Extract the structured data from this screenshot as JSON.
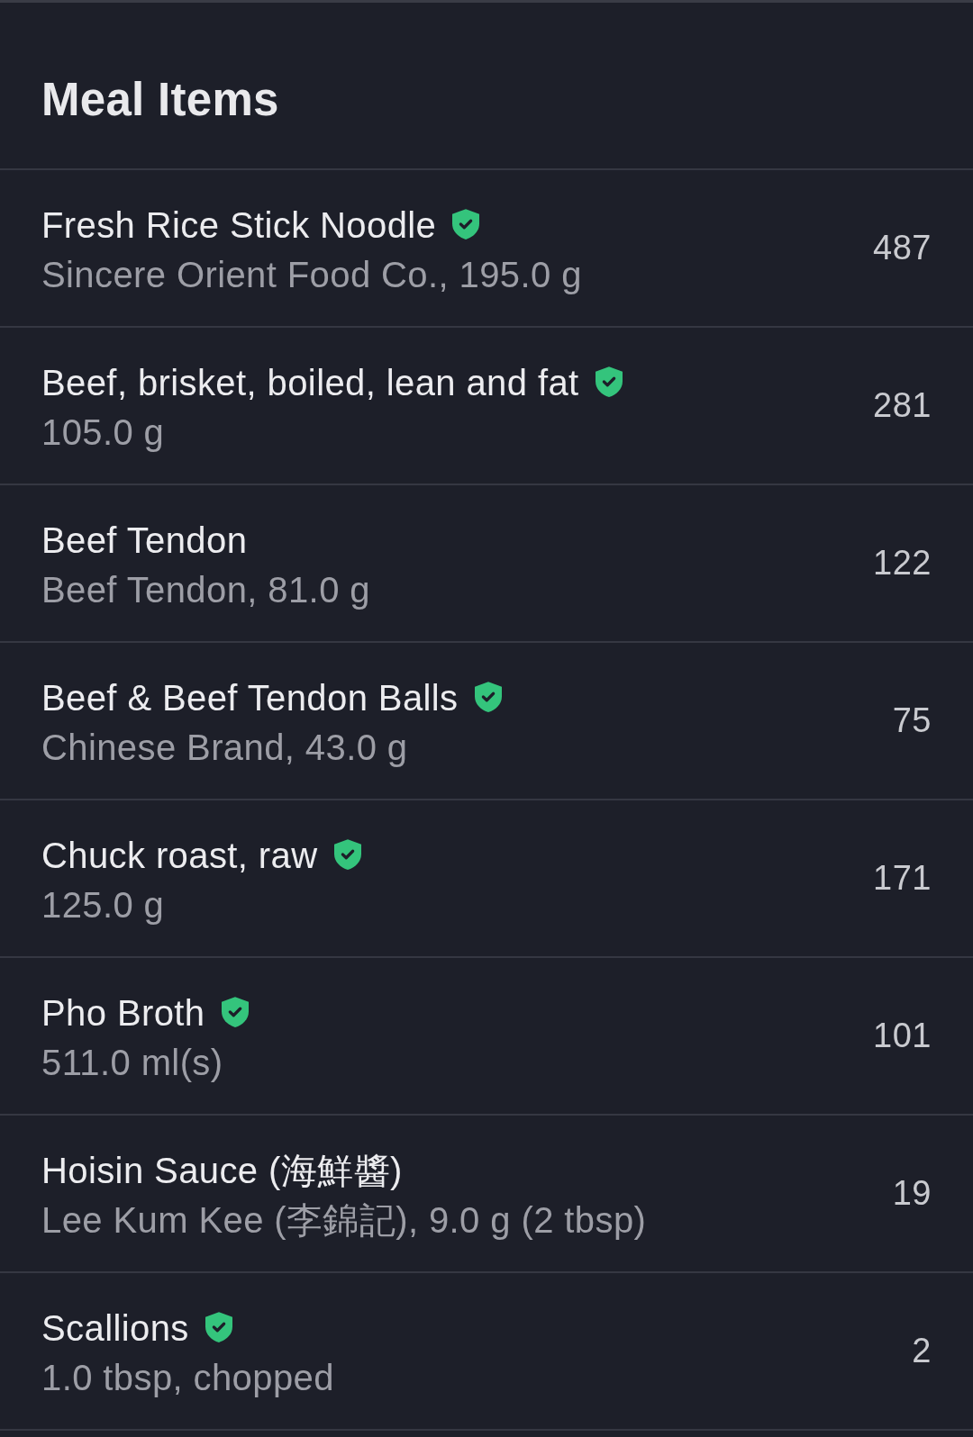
{
  "title": "Meal Items",
  "items": [
    {
      "name": "Fresh Rice Stick Noodle",
      "verified": true,
      "detail": "Sincere Orient Food Co., 195.0 g",
      "calories": "487"
    },
    {
      "name": "Beef, brisket, boiled, lean and fat",
      "verified": true,
      "detail": "105.0 g",
      "calories": "281"
    },
    {
      "name": "Beef Tendon",
      "verified": false,
      "detail": "Beef Tendon, 81.0 g",
      "calories": "122"
    },
    {
      "name": "Beef & Beef Tendon Balls",
      "verified": true,
      "detail": "Chinese Brand, 43.0 g",
      "calories": "75"
    },
    {
      "name": "Chuck roast, raw",
      "verified": true,
      "detail": "125.0 g",
      "calories": "171"
    },
    {
      "name": "Pho Broth",
      "verified": true,
      "detail": "511.0 ml(s)",
      "calories": "101"
    },
    {
      "name": "Hoisin Sauce (海鮮醬)",
      "verified": false,
      "detail": "Lee Kum Kee (李錦記), 9.0 g (2 tbsp)",
      "calories": "19"
    },
    {
      "name": "Scallions",
      "verified": true,
      "detail": "1.0 tbsp, chopped",
      "calories": "2"
    }
  ]
}
